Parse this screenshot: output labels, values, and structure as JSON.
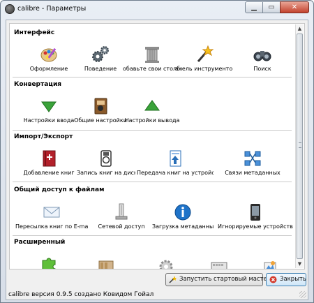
{
  "window": {
    "title": "calibre - Параметры"
  },
  "sections": [
    {
      "title": "Интерфейс",
      "items": [
        {
          "label": "Оформление",
          "icon": "palette-icon"
        },
        {
          "label": "Поведение",
          "icon": "gears-icon"
        },
        {
          "label": "обавьте свои столбц",
          "icon": "column-icon"
        },
        {
          "label": "анель инструменто",
          "icon": "magic-wand-icon"
        },
        {
          "label": "Поиск",
          "icon": "binoculars-icon"
        }
      ]
    },
    {
      "title": "Конвертация",
      "items": [
        {
          "label": "Настройки ввода",
          "icon": "arrow-down-icon"
        },
        {
          "label": "Общие настройки",
          "icon": "book-conversion-icon"
        },
        {
          "label": "Настройки вывода",
          "icon": "arrow-up-icon"
        }
      ]
    },
    {
      "title": "Импорт/Экспорт",
      "items": [
        {
          "label": "Добавление книг",
          "icon": "add-book-icon"
        },
        {
          "label": "Запись книг на диск",
          "icon": "disk-icon"
        },
        {
          "label": "Передача книг на устройства",
          "icon": "send-to-device-icon"
        },
        {
          "label": "Связи метаданных",
          "icon": "metadata-links-icon"
        }
      ]
    },
    {
      "title": "Общий доступ к файлам",
      "items": [
        {
          "label": "Пересылка книг по E-mail",
          "icon": "mail-icon"
        },
        {
          "label": "Сетевой доступ",
          "icon": "network-icon"
        },
        {
          "label": "Загрузка метаданных",
          "icon": "info-icon"
        },
        {
          "label": "Игнорируемые устройства",
          "icon": "device-icon"
        }
      ]
    },
    {
      "title": "Расширенный",
      "items": [
        {
          "label": "",
          "icon": "puzzle-icon"
        },
        {
          "label": "",
          "icon": "books-icon"
        },
        {
          "label": "",
          "icon": "gear-icon"
        },
        {
          "label": "",
          "icon": "keyboard-icon"
        },
        {
          "label": "",
          "icon": "tweaks-icon"
        }
      ]
    }
  ],
  "buttons": {
    "wizard": "Запустить стартовый мастер",
    "close": "Закрыть"
  },
  "status": "calibre версия 0.9.5 создано Ковидом Гойал"
}
